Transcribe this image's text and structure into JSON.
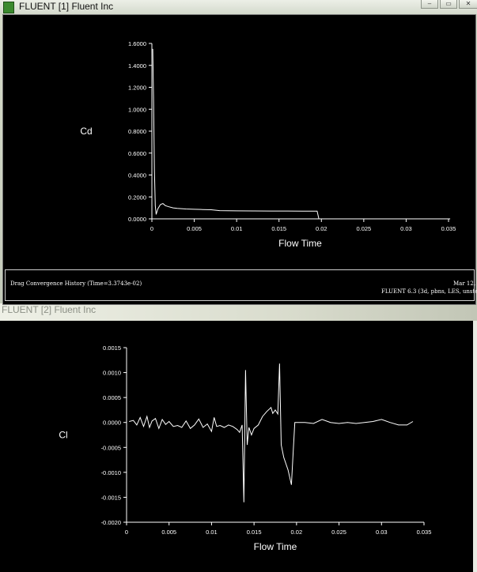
{
  "window1": {
    "title": "FLUENT [1] Fluent Inc",
    "footer_left": "Drag Convergence History  (Time=3.3743e-02)",
    "footer_date": "Mar 12, 2",
    "footer_version": "FLUENT 6.3 (3d, pbns, LES, unste"
  },
  "window2": {
    "title": "FLUENT [2] Fluent Inc"
  },
  "colors": {
    "plot_bg": "#000000",
    "plot_fg": "#ffffff"
  },
  "chart_data": [
    {
      "type": "line",
      "xlabel": "Flow Time",
      "ylabel": "Cd",
      "xlim": [
        0,
        0.035
      ],
      "ylim": [
        0,
        1.6
      ],
      "xticks": [
        0,
        0.005,
        0.01,
        0.015,
        0.02,
        0.025,
        0.03,
        0.035
      ],
      "xtick_labels": [
        "0",
        "0.005",
        "0.01",
        "0.015",
        "0.02",
        "0.025",
        "0.03",
        "0.035"
      ],
      "yticks": [
        0,
        0.2,
        0.4,
        0.6,
        0.8,
        1.0,
        1.2,
        1.4,
        1.6
      ],
      "ytick_labels": [
        "0.0000",
        "0.2000",
        "0.4000",
        "0.6000",
        "0.8000",
        "1.0000",
        "1.2000",
        "1.4000",
        "1.6000"
      ],
      "series": [
        {
          "x": [
            0.0001,
            0.0002,
            0.0003,
            0.0004,
            0.0005,
            0.0007,
            0.001,
            0.0013,
            0.0016,
            0.002,
            0.0025,
            0.003,
            0.004,
            0.005,
            0.006,
            0.007,
            0.008,
            0.009,
            0.01,
            0.012,
            0.014,
            0.016,
            0.018,
            0.0195,
            0.0197,
            0.02,
            0.022,
            0.025,
            0.028,
            0.031,
            0.034,
            0.0352
          ],
          "y": [
            1.55,
            1.1,
            0.45,
            0.12,
            0.04,
            0.09,
            0.13,
            0.14,
            0.12,
            0.11,
            0.1,
            0.095,
            0.09,
            0.087,
            0.085,
            0.083,
            0.075,
            0.074,
            0.073,
            0.072,
            0.071,
            0.071,
            0.07,
            0.07,
            0.0,
            0.0,
            0.0,
            0.0,
            0.0,
            0.0,
            0.0,
            0.0
          ]
        }
      ]
    },
    {
      "type": "line",
      "xlabel": "Flow Time",
      "ylabel": "Cl",
      "xlim": [
        0,
        0.035
      ],
      "ylim": [
        -0.002,
        0.0015
      ],
      "xticks": [
        0,
        0.005,
        0.01,
        0.015,
        0.02,
        0.025,
        0.03,
        0.035
      ],
      "xtick_labels": [
        "0",
        "0.005",
        "0.01",
        "0.015",
        "0.02",
        "0.025",
        "0.03",
        "0.035"
      ],
      "yticks": [
        -0.002,
        -0.0015,
        -0.001,
        -0.0005,
        0,
        0.0005,
        0.001,
        0.0015
      ],
      "ytick_labels": [
        "-0.0020",
        "-0.0015",
        "-0.0010",
        "-0.0005",
        "0.0000",
        "0.0005",
        "0.0010",
        "0.0015"
      ],
      "series": [
        {
          "x": [
            0.0003,
            0.0008,
            0.0012,
            0.0016,
            0.002,
            0.0024,
            0.0027,
            0.003,
            0.0034,
            0.0038,
            0.0042,
            0.0046,
            0.005,
            0.0055,
            0.006,
            0.0065,
            0.007,
            0.0075,
            0.008,
            0.0085,
            0.009,
            0.0095,
            0.01,
            0.0103,
            0.0106,
            0.011,
            0.0115,
            0.012,
            0.0125,
            0.013,
            0.0133,
            0.0136,
            0.0138,
            0.014,
            0.0142,
            0.0144,
            0.0147,
            0.015,
            0.0155,
            0.016,
            0.0165,
            0.017,
            0.0172,
            0.0175,
            0.0178,
            0.018,
            0.0182,
            0.0185,
            0.019,
            0.0194,
            0.0196,
            0.0198,
            0.02,
            0.021,
            0.022,
            0.023,
            0.024,
            0.025,
            0.026,
            0.027,
            0.028,
            0.029,
            0.03,
            0.031,
            0.032,
            0.033,
            0.0337
          ],
          "y": [
            2e-05,
            4e-05,
            -5e-05,
            0.0001,
            -8e-05,
            0.00012,
            -0.0001,
            3e-05,
            8e-05,
            -0.00012,
            6e-05,
            -4e-05,
            2e-05,
            -8e-05,
            -6e-05,
            -0.0001,
            3e-05,
            -0.00012,
            -5e-05,
            7e-05,
            -0.0001,
            -3e-05,
            -0.00018,
            0.0001,
            -8e-05,
            -6e-05,
            -0.0001,
            -5e-05,
            -8e-05,
            -0.00014,
            -0.0002,
            -5e-05,
            -0.0016,
            0.00105,
            -0.00045,
            -0.0001,
            -0.00025,
            -0.00012,
            -5e-05,
            0.00012,
            0.00022,
            0.0003,
            0.00018,
            0.00025,
            0.00017,
            0.00118,
            -0.00045,
            -0.0007,
            -0.00095,
            -0.00125,
            -0.0006,
            0.0,
            0.0,
            0.0,
            -2e-05,
            6e-05,
            0.0,
            -2e-05,
            0.0,
            -2e-05,
            0.0,
            2e-05,
            6e-05,
            0.0,
            -5e-05,
            -5e-05,
            2e-05
          ]
        }
      ]
    }
  ]
}
